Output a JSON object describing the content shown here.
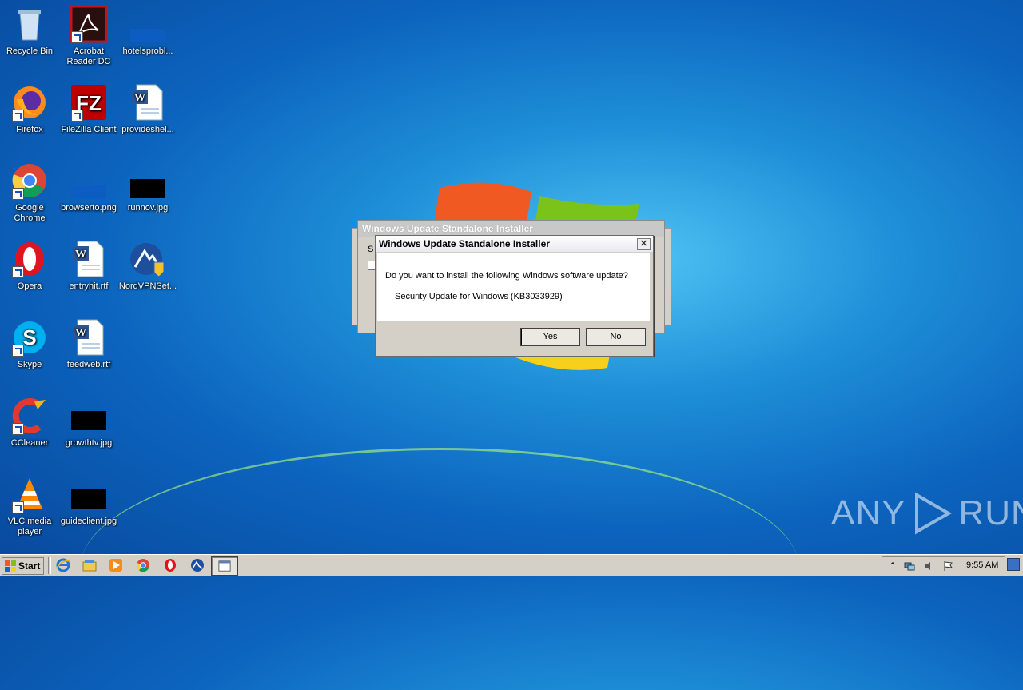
{
  "desktop": {
    "icons": [
      {
        "label": "Recycle Bin"
      },
      {
        "label": "Acrobat Reader DC"
      },
      {
        "label": "hotelsprobl..."
      },
      {
        "label": "Firefox"
      },
      {
        "label": "FileZilla Client"
      },
      {
        "label": "provideshel..."
      },
      {
        "label": "Google Chrome"
      },
      {
        "label": "browserto.png"
      },
      {
        "label": "runnov.jpg"
      },
      {
        "label": "Opera"
      },
      {
        "label": "entryhit.rtf"
      },
      {
        "label": "NordVPNSet..."
      },
      {
        "label": "Skype"
      },
      {
        "label": "feedweb.rtf"
      },
      {
        "label": "CCleaner"
      },
      {
        "label": "growthtv.jpg"
      },
      {
        "label": "VLC media player"
      },
      {
        "label": "guideclient.jpg"
      }
    ]
  },
  "back_window": {
    "title": "Windows Update Standalone Installer",
    "fragment": "S"
  },
  "dialog": {
    "title": "Windows Update Standalone Installer",
    "close_label": "✕",
    "message": "Do you want to install the following Windows software update?",
    "update_name": "Security Update for Windows (KB3033929)",
    "yes_label": "Yes",
    "no_label": "No"
  },
  "taskbar": {
    "start_label": "Start",
    "clock": "9:55 AM",
    "tray_icons": [
      "chevron-up-icon",
      "network-icon",
      "volume-icon",
      "flag-icon"
    ],
    "quick_launch": [
      "ie-icon",
      "explorer-icon",
      "media-player-icon",
      "chrome-icon",
      "opera-icon",
      "nordvpn-icon"
    ]
  },
  "watermark": {
    "left": "ANY",
    "right": "RUN"
  },
  "colors": {
    "accent": "#0c64be",
    "dialog_bg": "#d4d0c8"
  }
}
